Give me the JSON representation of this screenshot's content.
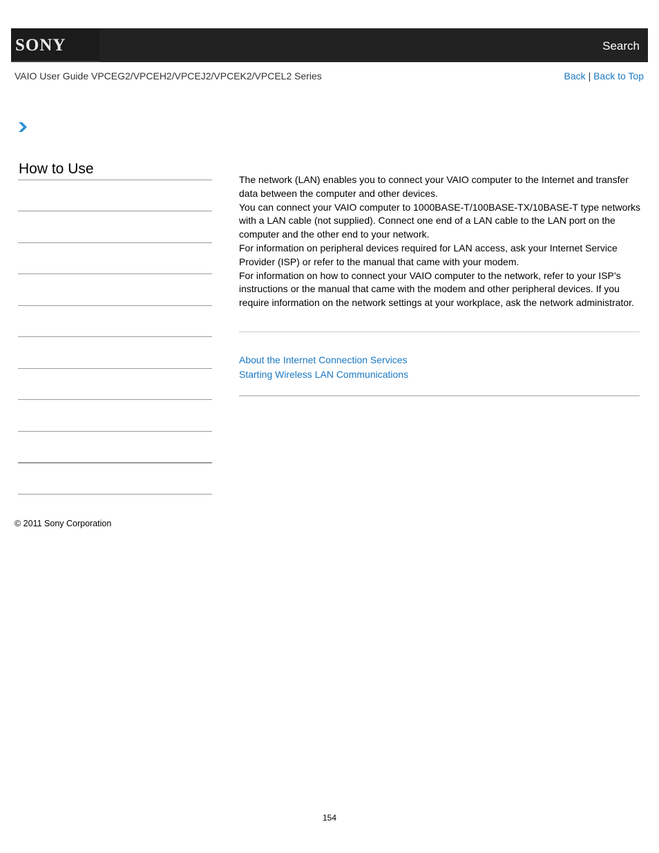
{
  "header": {
    "logo": "SONY",
    "search_label": "Search"
  },
  "subheader": {
    "guide_title": "VAIO User Guide VPCEG2/VPCEH2/VPCEJ2/VPCEK2/VPCEL2 Series",
    "back_label": "Back",
    "separator": "|",
    "back_to_top_label": "Back to Top"
  },
  "breadcrumb": {
    "icon": "chevron-right-icon"
  },
  "sidebar": {
    "title": "How to Use",
    "items": [
      "",
      "",
      "",
      "",
      "",
      "",
      "",
      "",
      "",
      "",
      ""
    ]
  },
  "main": {
    "paragraphs": [
      "The network (LAN) enables you to connect your VAIO computer to the Internet and transfer data between the computer and other devices.",
      "You can connect your VAIO computer to 1000BASE-T/100BASE-TX/10BASE-T type networks with a LAN cable (not supplied). Connect one end of a LAN cable to the LAN port on the computer and the other end to your network.",
      "For information on peripheral devices required for LAN access, ask your Internet Service Provider (ISP) or refer to the manual that came with your modem.",
      "For information on how to connect your VAIO computer to the network, refer to your ISP’s instructions or the manual that came with the modem and other peripheral devices. If you require information on the network settings at your workplace, ask the network administrator."
    ],
    "related_links": [
      "About the Internet Connection Services",
      "Starting Wireless LAN Communications"
    ]
  },
  "footer": {
    "copyright": "© 2011 Sony Corporation",
    "page_number": "154"
  },
  "colors": {
    "header_bg": "#222222",
    "link": "#1a78c2",
    "chevron": "#2b8fd6"
  }
}
